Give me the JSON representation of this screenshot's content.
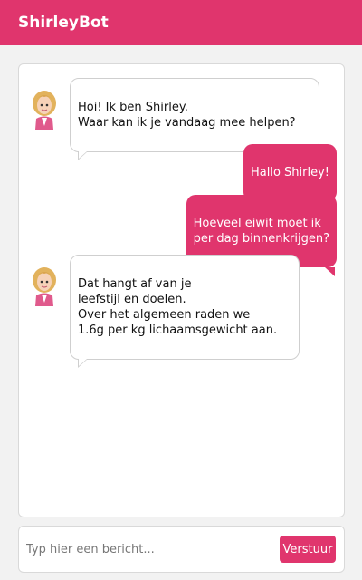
{
  "header": {
    "title": "ShirleyBot"
  },
  "messages": [
    {
      "from": "bot",
      "text": "Hoi! Ik ben Shirley.\nWaar kan ik je vandaag mee helpen?"
    },
    {
      "from": "user",
      "text": "Hallo Shirley!"
    },
    {
      "from": "user",
      "text": "Hoeveel eiwit moet ik\nper dag binnenkrijgen?"
    },
    {
      "from": "bot",
      "text": "Dat hangt af van je\nleefstijl en doelen.\nOver het algemeen raden we\n1.6g per kg lichaamsgewicht aan."
    }
  ],
  "composer": {
    "placeholder": "Typ hier een bericht...",
    "value": "",
    "send_label": "Verstuur"
  },
  "colors": {
    "accent": "#e0356d",
    "panel": "#ffffff",
    "background": "#f2f2f2"
  },
  "icons": {
    "bot_avatar": "shirley-avatar-icon"
  }
}
